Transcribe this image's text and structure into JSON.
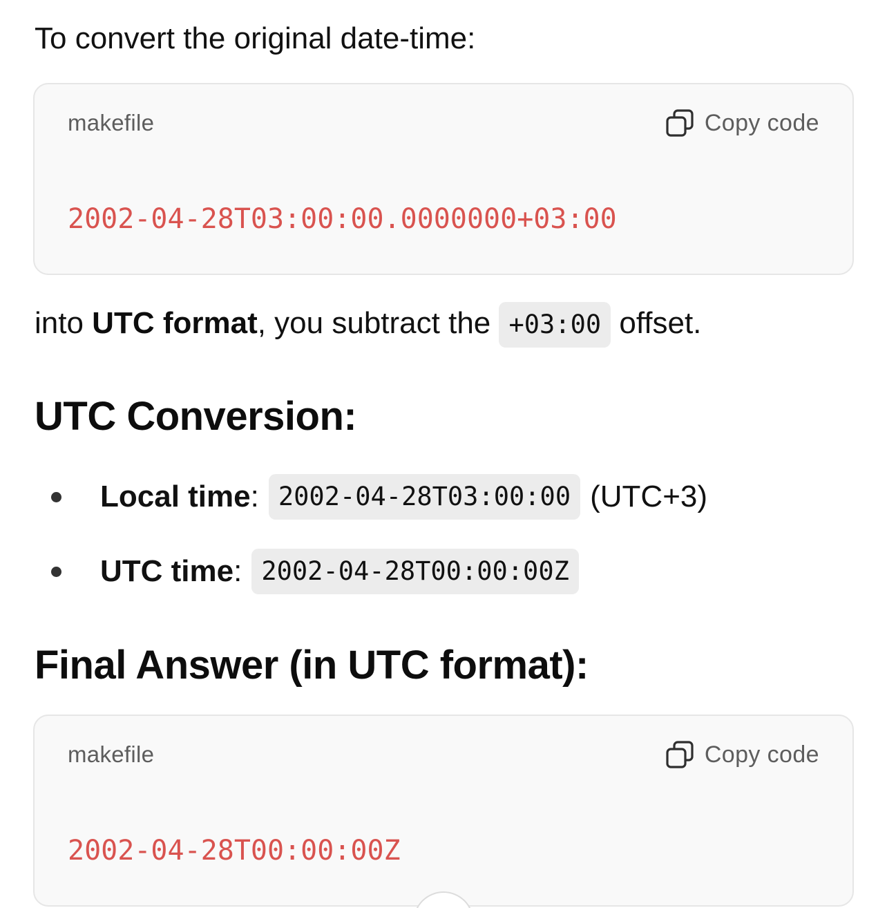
{
  "intro": {
    "text": "To convert the original date-time:"
  },
  "code_blocks": [
    {
      "language": "makefile",
      "copy_label": "Copy code",
      "code": "2002-04-28T03:00:00.0000000+03:00"
    },
    {
      "language": "makefile",
      "copy_label": "Copy code",
      "code": "2002-04-28T00:00:00Z"
    }
  ],
  "explanation": {
    "prefix": "into ",
    "bold": "UTC format",
    "middle": ", you subtract the ",
    "code": "+03:00",
    "suffix": " offset."
  },
  "section_utc": {
    "heading": "UTC Conversion:",
    "items": [
      {
        "label": "Local time",
        "sep": ":",
        "code": "2002-04-28T03:00:00",
        "suffix": "(UTC+3)"
      },
      {
        "label": "UTC time",
        "sep": ":",
        "code": "2002-04-28T00:00:00Z",
        "suffix": ""
      }
    ]
  },
  "section_final": {
    "heading": "Final Answer (in UTC format):"
  },
  "icons": {
    "copy": "copy-icon",
    "scroll": "scroll-down-button"
  },
  "colors": {
    "code_text": "#d9534f",
    "code_bg": "#f9f9f9",
    "inline_code_bg": "#ececec"
  }
}
